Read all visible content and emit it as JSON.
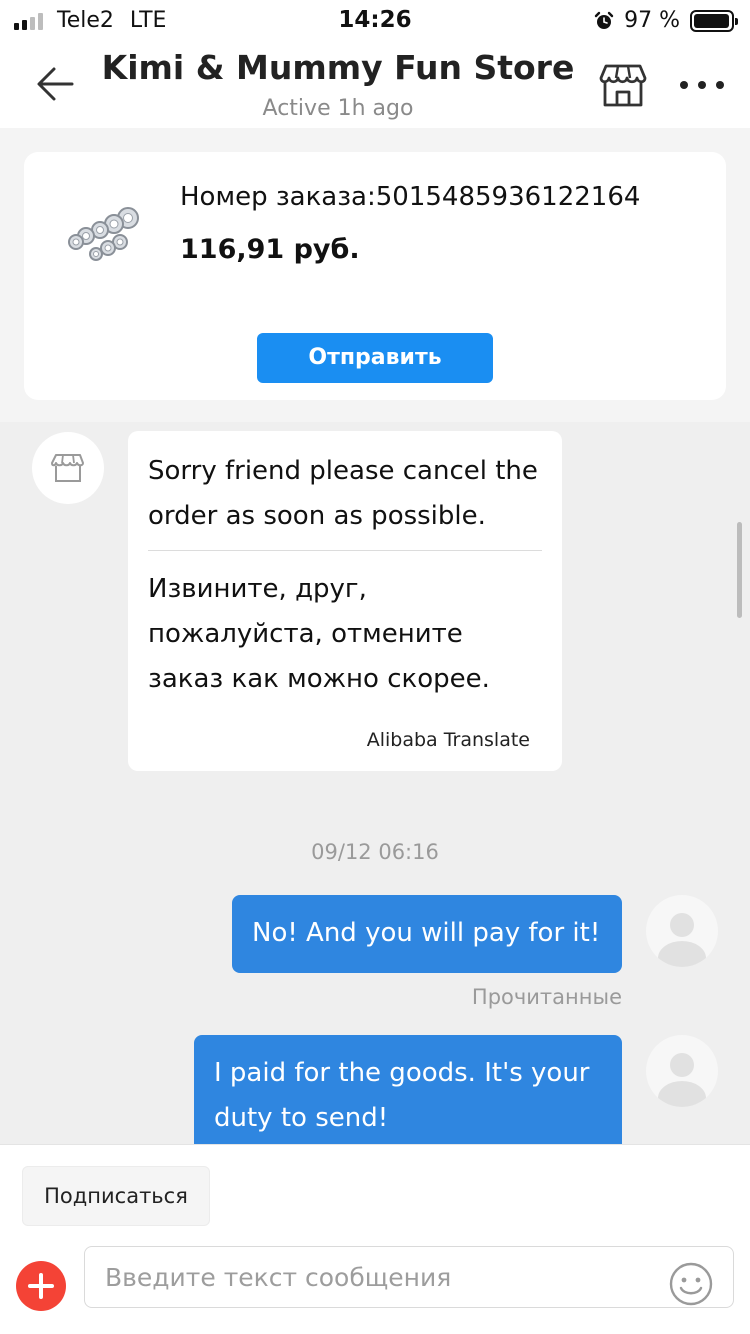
{
  "status_bar": {
    "carrier": "Tele2",
    "network": "LTE",
    "time": "14:26",
    "battery": "97 %",
    "battery_level": 0.97,
    "signal_bars": 2
  },
  "header": {
    "title": "Kimi & Mummy Fun Store",
    "subtitle": "Active 1h ago",
    "icons": [
      "back-arrow-icon",
      "store-icon",
      "more-icon"
    ]
  },
  "order": {
    "number_label": "Номер заказа:5015485936122164",
    "price": "116,91 руб.",
    "send_label": "Отправить"
  },
  "chat": {
    "incoming": {
      "text": "Sorry friend please cancel the order as soon as possible.",
      "translation": "Извините, друг, пожалуйста, отмените заказ как можно скорее.",
      "translator": "Alibaba Translate"
    },
    "timestamp": "09/12 06:16",
    "outgoing": [
      {
        "text": "No!  And you will pay for it!"
      },
      {
        "text": "I paid for the goods.  It's your duty to send!"
      }
    ],
    "read_status": "Прочитанные"
  },
  "footer": {
    "subscribe_label": "Подписаться",
    "input_placeholder": "Введите текст сообщения"
  },
  "colors": {
    "accent_blue": "#1a8ef2",
    "bubble_blue": "#2f86e0",
    "add_red": "#f44336"
  }
}
